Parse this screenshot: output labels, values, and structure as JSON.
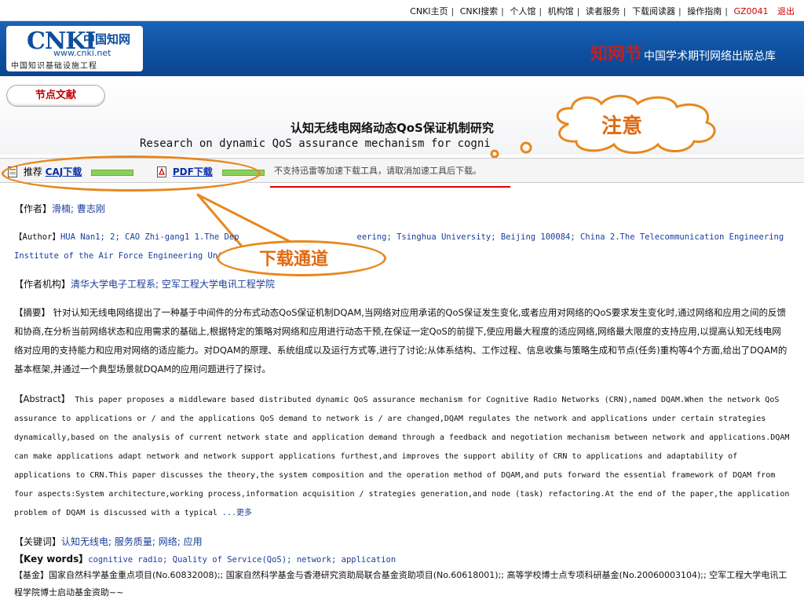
{
  "topnav": {
    "links": [
      "CNKI主页",
      "CNKI搜索",
      "个人馆",
      "机构馆",
      "读者服务",
      "下载阅读器",
      "操作指南"
    ],
    "user": "GZ0041",
    "logout": "退出"
  },
  "header": {
    "logo_text": "CNKI",
    "logo_cn": "中国知网",
    "logo_url": "www.cnki.net",
    "logo_sub": "中国知识基础设施工程",
    "zwj_logo": "知网节",
    "zwj_title": "中国学术期刊网络出版总库"
  },
  "tab": {
    "label": "节点文献"
  },
  "article": {
    "title_cn": "认知无线电网络动态QoS保证机制研究",
    "title_en": "Research on dynamic QoS assurance mechanism for cogni"
  },
  "download": {
    "recommend": "推荐",
    "caj": "CAJ下载",
    "pdf": "PDF下载",
    "notice": "不支持迅雷等加速下载工具，请取消加速工具后下载。"
  },
  "callouts": {
    "attention": "注意",
    "download_channel": "下载通道"
  },
  "meta": {
    "author_label": "【作者】",
    "authors": "滑楠;  曹志刚",
    "author_en_label": "【Author】",
    "author_en_line1": "HUA Nan1; 2; CAO Zhi-gang1 1.The Dep",
    "author_en_line1b": "eering; Tsinghua University; Beijing 100084; China 2.The Telecommunication Engineering",
    "author_en_line2": "Institute of the Air Force Engineering Univ",
    "org_label": "【作者机构】",
    "org": "清华大学电子工程系;  空军工程大学电讯工程学院",
    "abstract_label": "【摘要】",
    "abstract": "针对认知无线电网络提出了一种基于中间件的分布式动态QoS保证机制DQAM,当网络对应用承诺的QoS保证发生变化,或者应用对网络的QoS要求发生变化时,通过网络和应用之间的反馈和协商,在分析当前网络状态和应用需求的基础上,根据特定的策略对网络和应用进行动态干预,在保证一定QoS的前提下,使应用最大程度的适应网络,网络最大限度的支持应用,以提高认知无线电网络对应用的支持能力和应用对网络的适应能力。对DQAM的原理、系统组成以及运行方式等,进行了讨论;从体系结构、工作过程、信息收集与策略生成和节点(任务)重构等4个方面,给出了DQAM的基本框架,并通过一个典型场景就DQAM的应用问题进行了探讨。",
    "abstract_en_label": "【Abstract】",
    "abstract_en": "This paper proposes a middleware based distributed dynamic QoS assurance mechanism for Cognitive Radio Networks (CRN),named DQAM.When the network QoS assurance to applications or / and the applications QoS demand to network is / are changed,DQAM regulates the network and applications under certain strategies dynamically,based on the analysis of current network state and application demand through a feedback and negotiation mechanism between network and applications.DQAM can make applications adapt network and network support applications furthest,and improves the support ability of CRN to applications and adaptability of applications to CRN.This paper discusses the theory,the system composition and the operation method of DQAM,and puts forward the essential framework of DQAM from four aspects:System architecture,working process,information acquisition / strategies generation,and node (task) refactoring.At the end of the paper,the application problem of DQAM is discussed with a typical ",
    "more": "...更多",
    "keywords_label": "【关键词】",
    "keywords": "认知无线电;  服务质量;  网络;  应用",
    "keywords_en_label": "【Key words】",
    "keywords_en": "cognitive radio;  Quality of Service(QoS);  network;  application",
    "fund_label": "【基金】",
    "fund": "国家自然科学基金重点项目(No.60832008);;  国家自然科学基金与香港研究资助局联合基金资助项目(No.60618001);;  高等学校博士点专项科研基金(No.20060003104);;  空军工程大学电讯工程学院博士启动基金资助~~"
  }
}
